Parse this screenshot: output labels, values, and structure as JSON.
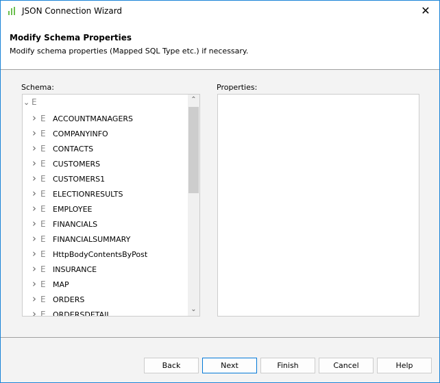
{
  "window": {
    "title": "JSON Connection Wizard",
    "close_glyph": "✕"
  },
  "header": {
    "title": "Modify Schema Properties",
    "subtitle": "Modify schema properties (Mapped SQL Type etc.) if necessary."
  },
  "schema": {
    "label": "Schema:",
    "root": "E",
    "items": [
      "ACCOUNTMANAGERS",
      "COMPANYINFO",
      "CONTACTS",
      "CUSTOMERS",
      "CUSTOMERS1",
      "ELECTIONRESULTS",
      "EMPLOYEE",
      "FINANCIALS",
      "FINANCIALSUMMARY",
      "HttpBodyContentsByPost",
      "INSURANCE",
      "MAP",
      "ORDERS",
      "ORDERSDETAIL"
    ],
    "item_icon": "E"
  },
  "properties": {
    "label": "Properties:"
  },
  "buttons": {
    "back": "Back",
    "next": "Next",
    "finish": "Finish",
    "cancel": "Cancel",
    "help": "Help"
  },
  "colors": {
    "accent": "#0078d7",
    "icon_green": "#5cb85c"
  }
}
